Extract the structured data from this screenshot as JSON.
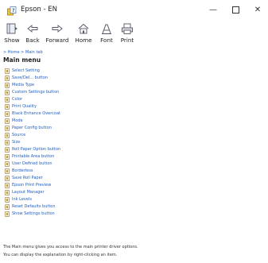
{
  "window": {
    "title": "Epson - EN",
    "controls": {
      "minimize": "—",
      "close": "✕"
    }
  },
  "toolbar": {
    "buttons": [
      {
        "label": "Show",
        "icon": "show-icon"
      },
      {
        "label": "Back",
        "icon": "back-arrow-icon"
      },
      {
        "label": "Forward",
        "icon": "forward-arrow-icon"
      },
      {
        "label": "Home",
        "icon": "home-icon"
      },
      {
        "label": "Font",
        "icon": "font-icon"
      },
      {
        "label": "Print",
        "icon": "print-icon"
      }
    ]
  },
  "breadcrumb": "> Home > Main tab",
  "page_title": "Main menu",
  "menu_items": [
    "Select Setting",
    "Save/Del... button",
    "Media Type",
    "Custom Settings button",
    "Color",
    "Print Quality",
    "Black Enhance Overcoat",
    "Mode",
    "Paper Config button",
    "Source",
    "Size",
    "Roll Paper Option button",
    "Printable Area button",
    "User Defined button",
    "Borderless",
    "Save Roll Paper",
    "Epson Print Preview",
    "Layout Manager",
    "Ink Levels",
    "Reset Defaults button",
    "Show Settings button"
  ],
  "footer": {
    "line1": "The Main menu gives you access to the main printer driver options.",
    "line2": "You can display the explanation by right-clicking an item."
  },
  "colors": {
    "link": "#1f5fc0",
    "background": "#ffffff"
  }
}
